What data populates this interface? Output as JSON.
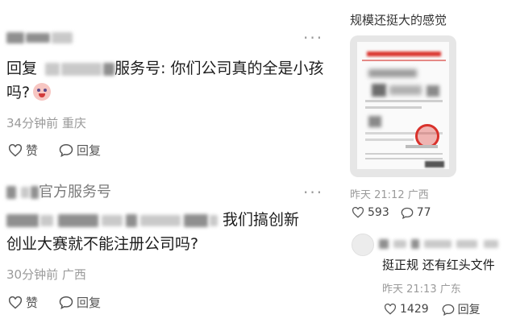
{
  "comments": [
    {
      "username_visible": "",
      "reply_prefix": "回复",
      "reply_target_visible": "服务号",
      "reply_text_line1": ": 你们公司真的全是小孩",
      "reply_text_line2": "吗?",
      "emoji_icon": "crying-face-emoji",
      "time": "34分钟前",
      "location": "重庆",
      "like_label": "赞",
      "reply_label": "回复"
    },
    {
      "username_visible": "官方服务号",
      "text_line1": "我们搞创新",
      "text_line2": "创业大赛就不能注册公司吗?",
      "time": "30分钟前",
      "location": "广西",
      "like_label": "赞",
      "reply_label": "回复"
    }
  ],
  "side_post": {
    "title": "规模还挺大的感觉",
    "time": "昨天 21:12",
    "location": "广西",
    "likes": "593",
    "replies": "77",
    "reply": {
      "text": "挺正规  还有红头文件",
      "time": "昨天 21:13",
      "location": "广东",
      "likes": "1429",
      "reply_label": "回复"
    }
  },
  "colors": {
    "accent_red": "#d9312b",
    "meta_gray": "#9a9a9a"
  },
  "icons": {
    "like": "heart-outline-icon",
    "reply": "speech-bubble-icon",
    "more": "more-dots-icon"
  }
}
